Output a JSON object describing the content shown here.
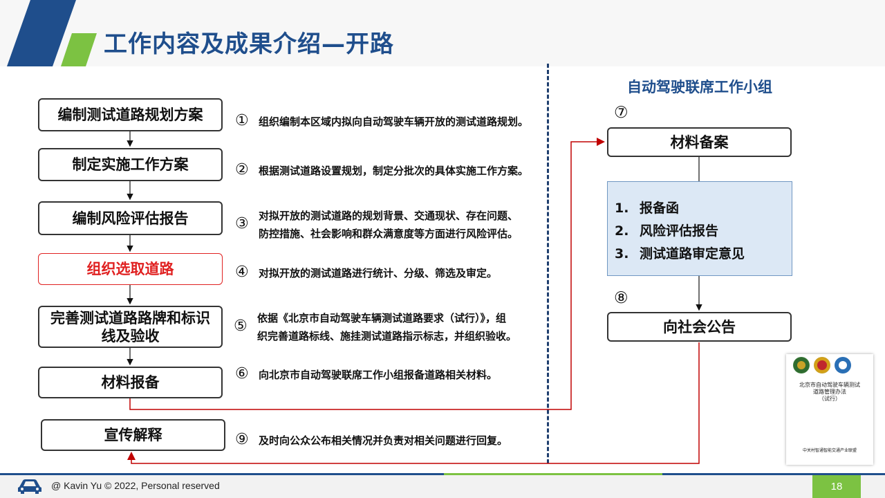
{
  "title": "工作内容及成果介绍—开路",
  "flow_boxes": [
    {
      "label": "编制测试道路规划方案",
      "highlight": false
    },
    {
      "label": "制定实施工作方案",
      "highlight": false
    },
    {
      "label": "编制风险评估报告",
      "highlight": false
    },
    {
      "label": "组织选取道路",
      "highlight": true
    },
    {
      "label": "完善测试道路路牌和标识\n线及验收",
      "highlight": false
    },
    {
      "label": "材料报备",
      "highlight": false
    },
    {
      "label": "宣传解释",
      "highlight": false
    }
  ],
  "steps": [
    {
      "num": "①",
      "text": "组织编制本区域内拟向自动驾驶车辆开放的测试道路规划。"
    },
    {
      "num": "②",
      "text": "根据测试道路设置规划，制定分批次的具体实施工作方案。"
    },
    {
      "num": "③",
      "text": "对拟开放的测试道路的规划背景、交通现状、存在问题、\n防控措施、社会影响和群众满意度等方面进行风险评估。"
    },
    {
      "num": "④",
      "text": "对拟开放的测试道路进行统计、分级、筛选及审定。"
    },
    {
      "num": "⑤",
      "text": "依据《北京市自动驾驶车辆测试道路要求（试行）》，组\n织完善道路标线、施挂测试道路指示标志，并组织验收。"
    },
    {
      "num": "⑥",
      "text": "向北京市自动驾驶联席工作小组报备道路相关材料。"
    },
    {
      "num": "⑨",
      "text": "及时向公众公布相关情况并负责对相关问题进行回复。"
    }
  ],
  "right_group": {
    "title": "自动驾驶联席工作小组",
    "label_7": "⑦",
    "box_filing": "材料备案",
    "list": [
      {
        "num": "1.",
        "text": "报备函"
      },
      {
        "num": "2.",
        "text": "风险评估报告"
      },
      {
        "num": "3.",
        "text": "测试道路审定意见"
      }
    ],
    "label_8": "⑧",
    "box_announce": "向社会公告"
  },
  "document": {
    "title": "北京市自动驾驶车辆测试\n道路管理办法\n（试行）",
    "footer": "中关村智通智能交通产业联盟"
  },
  "footer": {
    "copyright": "@ Kavin Yu © 2022,  Personal reserved",
    "page_number": "18"
  },
  "colors": {
    "title_blue": "#1f4e8c",
    "accent_green": "#7cc242",
    "highlight_red": "#e02020",
    "arrow_red": "#c00000",
    "list_fill": "#dce8f5"
  },
  "icons": [
    "car-icon",
    "arrow-icon"
  ]
}
